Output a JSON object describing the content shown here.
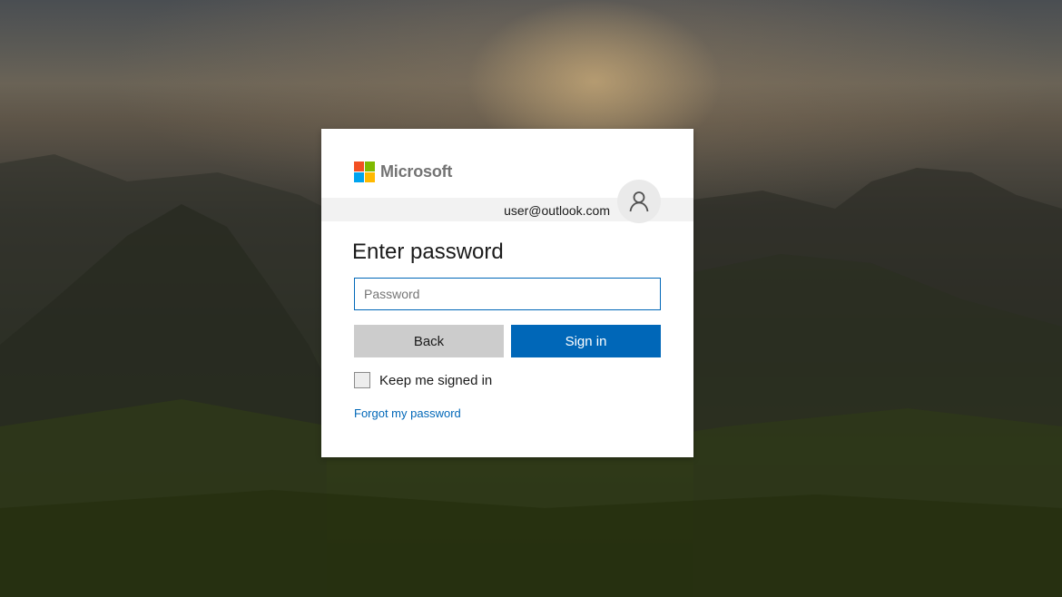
{
  "brand": {
    "name": "Microsoft",
    "logo_colors": [
      "#f25022",
      "#7fba00",
      "#00a4ef",
      "#ffb900"
    ]
  },
  "identity": {
    "email": "user@outlook.com",
    "avatar_icon": "user-icon"
  },
  "form": {
    "title": "Enter password",
    "password_placeholder": "Password",
    "password_value": ""
  },
  "buttons": {
    "back_label": "Back",
    "signin_label": "Sign in"
  },
  "options": {
    "keep_signed_in_label": "Keep me signed in",
    "keep_signed_in_checked": false
  },
  "links": {
    "forgot_password": "Forgot my password"
  },
  "colors": {
    "accent": "#0067b8",
    "back_button": "#cccccc"
  }
}
